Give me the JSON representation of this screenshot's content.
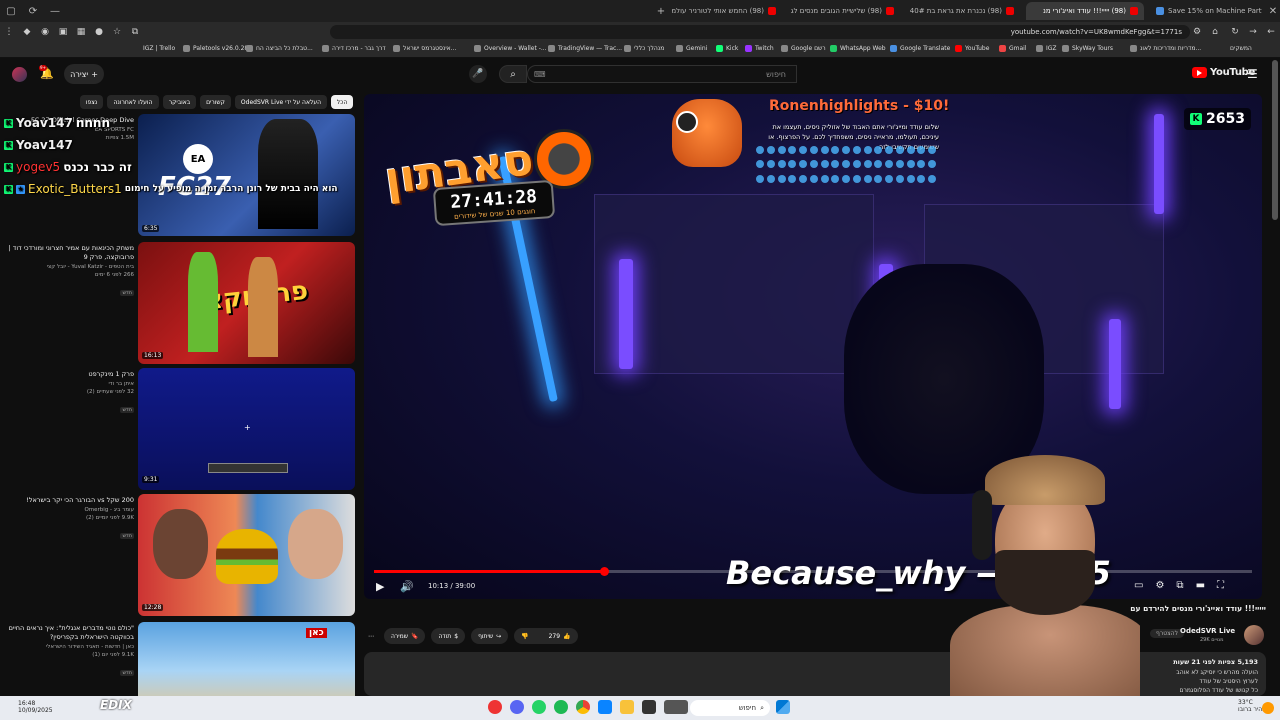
{
  "browser": {
    "tabs": [
      {
        "label": "(98) החמש אותי לטורניר עולמי",
        "active": false
      },
      {
        "label": "(98) שלישיית הגובים מנסים לג",
        "active": false
      },
      {
        "label": "(98) נכנרת את גראת בת 40#",
        "active": false
      },
      {
        "label": "(98) ייייי!!! עודד ואייג'ורי מנ",
        "active": true
      },
      {
        "label": "Save 15% on Machine Party on",
        "active": false
      }
    ],
    "url": "youtube.com/watch?v=UK8wmdKeFgg&t=1771s",
    "bookmarks": [
      "IGZ | Trello",
      "Paletools v26.0.28",
      "טבלת כל הביצה הח...",
      "דרך גבר - מרכז דירה",
      "אינסטגרמס ישראל...",
      "Overview - Wallet -...",
      "TradingView — Trac...",
      "מנהלך כללי",
      "Gemini",
      "Kick",
      "Twitch",
      "Google רשם",
      "WhatsApp Web",
      "Google Translate",
      "YouTube",
      "Gmail",
      "IGZ",
      "SkyWay Tours",
      "מדריות ומדריכות לאונ...",
      "המשקים"
    ]
  },
  "youtube": {
    "create_label": "יצירה",
    "notif_count": "9+",
    "search_placeholder": "חיפוש",
    "logo_text": "YouTube",
    "chips": [
      "הכל",
      "OdedSVR Live העלאה על ידי",
      "קשורים",
      "באוביקר",
      "הועלו לאחרונה",
      "נצפו"
    ],
    "recommendations": [
      {
        "title": "FC 27 Official Career Deep Dive",
        "channel": "EA SPORTS FC",
        "views": "1.5M צפיות",
        "duration": "6:35"
      },
      {
        "title": "משחק הכינאות עם אמיר חצרוני ומורדכי דוד | פרובוקצה, פרק 9",
        "channel": "בית הטפים - Yuval Katzir - יובל קצי",
        "views": "266 לפני 6 ימים",
        "badge": "חדש",
        "duration": "16:13"
      },
      {
        "title": "פרק 1 מינקרפט",
        "channel": "איתן בר ודי",
        "views": "32 לפני שעתיים (2)",
        "badge": "חדש",
        "duration": "9:31"
      },
      {
        "title": "200 שקל vs הבורגר הכי יקר בישראל!",
        "channel": "עומר ביג - Omerbig",
        "views": "9.9K לפני יומיים (2)",
        "badge": "חדש",
        "duration": "12:28"
      },
      {
        "title": "\"כולם נוטי מדברים אנגלית\": איך נראים החיים בכווקטה הישראלית בקפריסין?",
        "channel": "כאן | חדשות - תאגיד השידור הישראלי",
        "views": "9.1K לפני יום (1)",
        "badge": "חדש",
        "duration": ""
      }
    ],
    "chat": [
      {
        "name": "Yoav147",
        "msg": "nnnn",
        "color": "#ffffff"
      },
      {
        "name": "Yoav147",
        "msg": "",
        "color": "#ffffff"
      },
      {
        "name": "yogev5",
        "msg": "זה כבר נכנס",
        "color": "#ff3333"
      },
      {
        "name": "Exotic_Butters1",
        "msg": "הוא היה בבית של רונן הרבה זמן ה מופיע על חימום",
        "color": "#ffd84a"
      }
    ],
    "overlay": {
      "sabaton_title": "סאבתון",
      "timer": "27:41:28",
      "timer_sub": "חוגגים 10 שנים של שידורים",
      "donation_head": "Ronenhighlights - $10!",
      "donation_msg": "שלום עודד ומייג'ורי אתם האבוד של אזוליק ניסים, תעצמו את עיניכם, תעולמו, מראייה ניסים, משפחדיך לכם. על הפרצוף. או ששומעים תקשיבו לזה",
      "viewer_count": "2653",
      "alert_text": "Because_why — - $25"
    },
    "player": {
      "time": "10:13 / 39:00",
      "progress": 0.262
    },
    "video": {
      "title": "ייייי!!! עודד ואייג'ורי מנסים להירדם עם",
      "channel": "OdedSVR Live",
      "subs": "29K מנויים",
      "join_label": "להצטרף",
      "likes": "279",
      "share_label": "שיתוף",
      "thanks_label": "תודה",
      "save_label": "שמירה",
      "views_line": "5,193 צפיות לפני 21 שעות",
      "desc_line1": "הועלה מהרש כי יוסיקג לא אוהב",
      "desc_line2": "לערוץ היסטיב של עודד",
      "desc_line3": "כל קנושו של עודד הפלוסגמרם"
    }
  },
  "taskbar": {
    "search_label": "חיפוש",
    "weather": "33°C",
    "weather_sub": "בהיר ברובו",
    "clock": "16:48",
    "date": "10/09/2025"
  },
  "colors": {
    "youtube_red": "#ff0000",
    "kick_green": "#1fef77",
    "background": "#0f0f0f"
  }
}
